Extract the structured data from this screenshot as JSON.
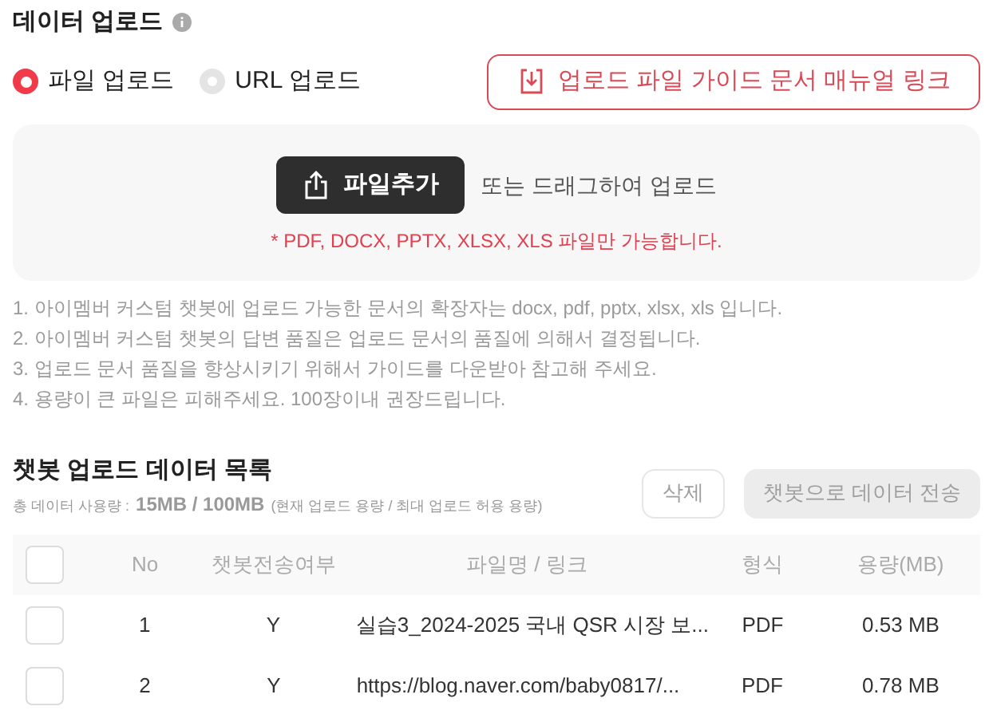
{
  "title": "데이터 업로드",
  "upload_modes": [
    {
      "label": "파일 업로드",
      "selected": true
    },
    {
      "label": "URL 업로드",
      "selected": false
    }
  ],
  "guide_link": "업로드 파일 가이드 문서 매뉴얼 링크",
  "dropzone": {
    "button": "파일추가",
    "hint": "또는 드래그하여 업로드",
    "allowed": "* PDF, DOCX, PPTX, XLSX, XLS 파일만 가능합니다."
  },
  "notes": [
    "1. 아이멤버 커스텀 챗봇에 업로드 가능한 문서의 확장자는 docx, pdf, pptx, xlsx, xls 입니다.",
    "2. 아이멤버 커스텀 챗봇의 답변 품질은 업로드 문서의 품질에 의해서 결정됩니다.",
    "3. 업로드 문서 품질을 향상시키기 위해서 가이드를 다운받아 참고해 주세요.",
    "4. 용량이 큰 파일은 피해주세요. 100장이내 권장드립니다."
  ],
  "list": {
    "title": "챗봇 업로드 데이터 목록",
    "usage_label": "총 데이터 사용량 :",
    "usage": "15MB / 100MB",
    "usage_note": "(현재 업로드 용량 / 최대 업로드 허용 용량)",
    "buttons": [
      {
        "label": "삭제",
        "kind": "outline",
        "disabled": true
      },
      {
        "label": "챗봇으로 데이터 전송",
        "kind": "filled",
        "disabled": true
      }
    ]
  },
  "table": {
    "select_all": {
      "checked": false
    },
    "columns": [
      "No",
      "챗봇전송여부",
      "파일명 / 링크",
      "형식",
      "용량(MB)"
    ],
    "rows": [
      {
        "checked": false,
        "cells": [
          "1",
          "Y",
          "실습3_2024-2025 국내 QSR 시장 보...",
          "PDF",
          "0.53 MB"
        ]
      },
      {
        "checked": false,
        "cells": [
          "2",
          "Y",
          "https://blog.naver.com/baby0817/...",
          "PDF",
          "0.78 MB"
        ]
      }
    ]
  }
}
